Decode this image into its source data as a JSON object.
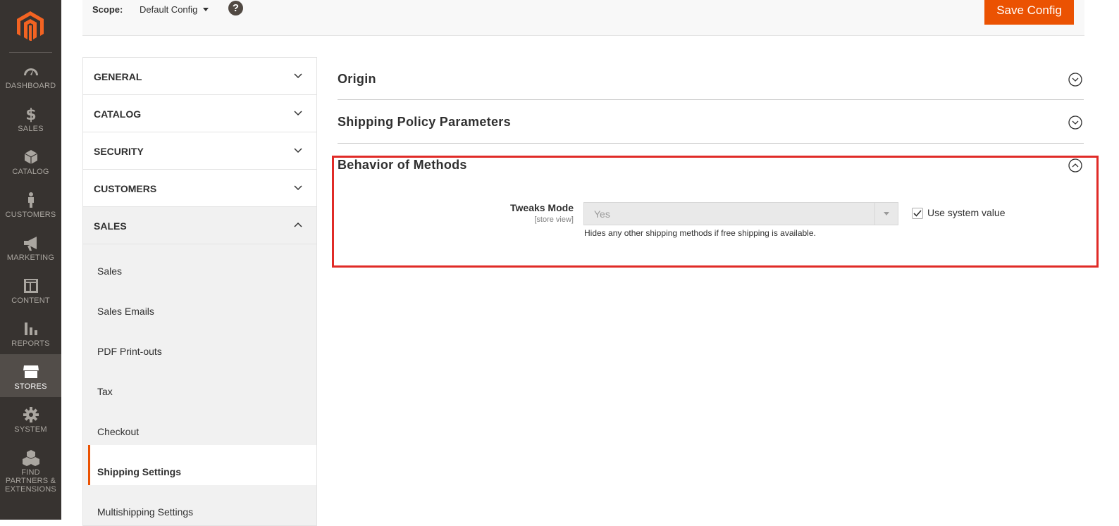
{
  "nav": {
    "items": [
      {
        "label": "DASHBOARD",
        "icon": "dashboard-icon"
      },
      {
        "label": "SALES",
        "icon": "dollar-icon"
      },
      {
        "label": "CATALOG",
        "icon": "box-icon"
      },
      {
        "label": "CUSTOMERS",
        "icon": "person-icon"
      },
      {
        "label": "MARKETING",
        "icon": "megaphone-icon"
      },
      {
        "label": "CONTENT",
        "icon": "layout-icon"
      },
      {
        "label": "REPORTS",
        "icon": "bar-chart-icon"
      },
      {
        "label": "STORES",
        "icon": "store-icon",
        "active": true
      },
      {
        "label": "SYSTEM",
        "icon": "gear-icon"
      },
      {
        "label": "FIND PARTNERS & EXTENSIONS",
        "icon": "cubes-icon"
      }
    ],
    "accent": "#eb5202"
  },
  "scope": {
    "label": "Scope:",
    "value": "Default Config",
    "help": "?"
  },
  "toolbar": {
    "save_label": "Save Config"
  },
  "tabs": {
    "general": "GENERAL",
    "catalog": "CATALOG",
    "security": "SECURITY",
    "customers": "CUSTOMERS",
    "sales": "SALES",
    "sales_items": [
      "Sales",
      "Sales Emails",
      "PDF Print-outs",
      "Tax",
      "Checkout",
      "Shipping Settings",
      "Multishipping Settings"
    ]
  },
  "sections": {
    "origin": "Origin",
    "policy": "Shipping Policy Parameters",
    "behavior": "Behavior of Methods"
  },
  "field": {
    "label": "Tweaks Mode",
    "scope": "[store view]",
    "value": "Yes",
    "note": "Hides any other shipping methods if free shipping is available.",
    "use_system_label": "Use system value",
    "use_system_checked": true
  }
}
